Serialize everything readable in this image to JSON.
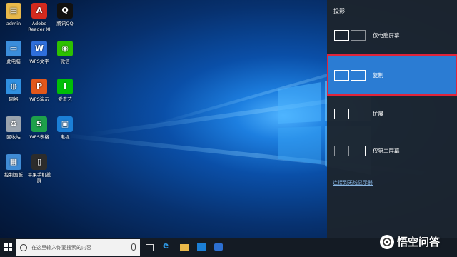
{
  "desktop": {
    "icons": [
      {
        "label": "admin",
        "icon": "user-folder-icon",
        "color": "#e8b84a"
      },
      {
        "label": "Adobe Reader XI",
        "icon": "adobe-reader-icon",
        "color": "#d42a1e"
      },
      {
        "label": "腾讯QQ",
        "icon": "qq-penguin-icon",
        "color": "#111111"
      },
      {
        "label": "此电脑",
        "icon": "computer-icon",
        "color": "#3b8ddb"
      },
      {
        "label": "WPS文字",
        "icon": "wps-writer-icon",
        "color": "#2f6fdb"
      },
      {
        "label": "微信",
        "icon": "wechat-icon",
        "color": "#2dc100"
      },
      {
        "label": "网络",
        "icon": "network-globe-icon",
        "color": "#2f8fe0"
      },
      {
        "label": "WPS演示",
        "icon": "wps-presentation-icon",
        "color": "#e2571b"
      },
      {
        "label": "爱奇艺",
        "icon": "iqiyi-icon",
        "color": "#00be06"
      },
      {
        "label": "回收站",
        "icon": "recycle-bin-icon",
        "color": "#9aa3ad"
      },
      {
        "label": "WPS表格",
        "icon": "wps-spreadsheet-icon",
        "color": "#1ea14a"
      },
      {
        "label": "电视",
        "icon": "tv-icon",
        "color": "#1b7fd6"
      },
      {
        "label": "控制面板",
        "icon": "control-panel-icon",
        "color": "#3f8bd4"
      },
      {
        "label": "苹果手机投屏",
        "icon": "phone-cast-icon",
        "color": "#2c2c2c"
      }
    ]
  },
  "panel": {
    "title": "投影",
    "options": [
      {
        "label": "仅电脑屏幕",
        "icon": "pc-screen-only-icon",
        "selected": false
      },
      {
        "label": "复制",
        "icon": "duplicate-icon",
        "selected": true
      },
      {
        "label": "扩展",
        "icon": "extend-icon",
        "selected": false
      },
      {
        "label": "仅第二屏幕",
        "icon": "second-screen-only-icon",
        "selected": false
      }
    ],
    "wireless_link": "连接到无线显示器"
  },
  "taskbar": {
    "search_placeholder": "在这里输入你要搜索的内容"
  },
  "watermark": "悟空问答",
  "colors": {
    "selected_bg": "#2b7cd3",
    "highlight_border": "#e0243a",
    "panel_bg": "#1c242e"
  }
}
